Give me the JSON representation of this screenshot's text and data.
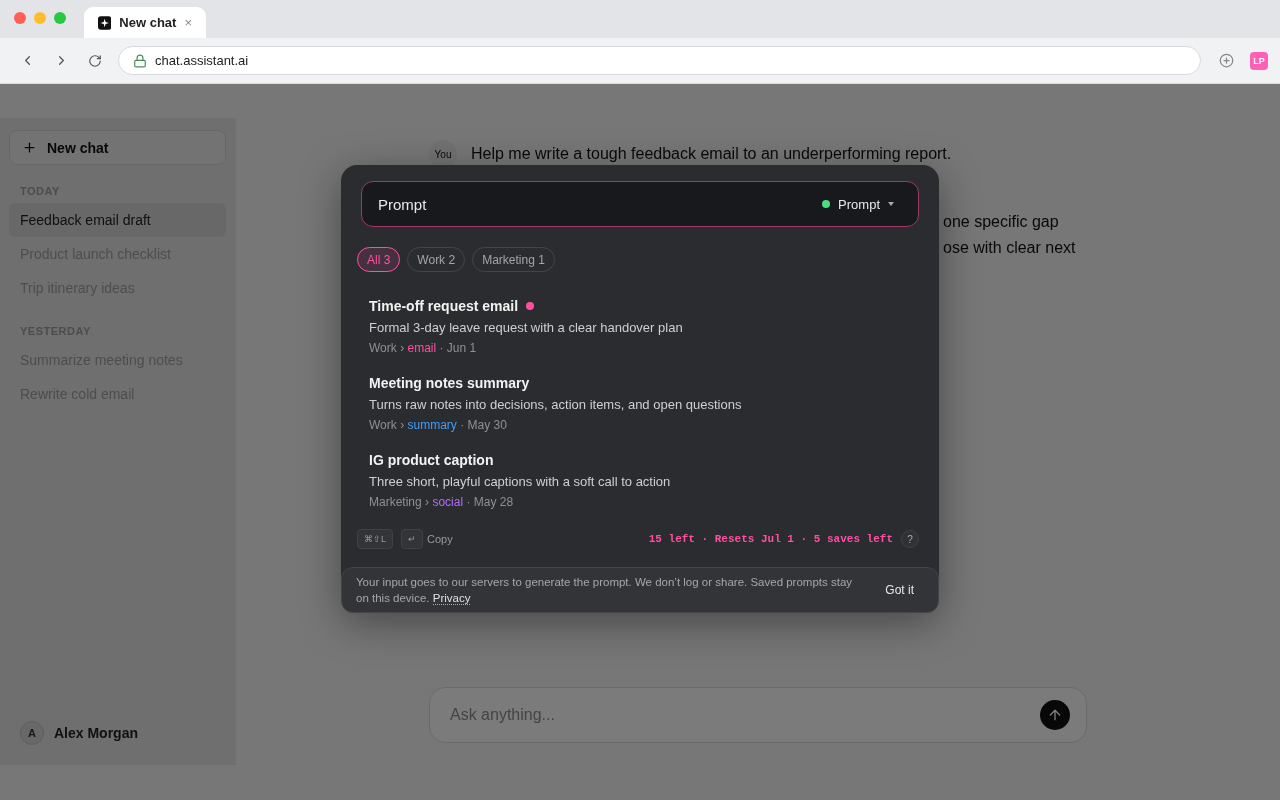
{
  "browser": {
    "tab": {
      "title": "New chat",
      "close": "×",
      "selected": true
    },
    "url": "chat.assistant.ai",
    "extension": "LP"
  },
  "sidebar": {
    "new_chat": "New chat",
    "sections": [
      {
        "heading": "TODAY",
        "items": [
          {
            "label": "Feedback email draft",
            "selected": true
          },
          {
            "label": "Product launch checklist",
            "selected": false
          },
          {
            "label": "Trip itinerary ideas",
            "selected": false
          }
        ]
      },
      {
        "heading": "YESTERDAY",
        "items": [
          {
            "label": "Summarize meeting notes",
            "selected": false
          },
          {
            "label": "Rewrite cold email",
            "selected": false
          }
        ]
      }
    ],
    "user": {
      "initial": "A",
      "name": "Alex Morgan"
    }
  },
  "chat": {
    "messages": [
      {
        "kind": "user",
        "avatar": "You",
        "text": "Help me write a tough feedback email to an underperforming report."
      },
      {
        "kind": "assistant",
        "lines": [
          "one specific gap",
          "ose with clear next"
        ]
      }
    ],
    "composer": {
      "placeholder": "Ask anything..."
    }
  },
  "popup": {
    "input": {
      "value": "Prompt"
    },
    "mode": {
      "label": "Prompt",
      "color": "#4ade80"
    },
    "filters": [
      {
        "label": "All 3",
        "selected": true
      },
      {
        "label": "Work 2",
        "selected": false
      },
      {
        "label": "Marketing 1",
        "selected": false
      }
    ],
    "separators": {
      "path": "›",
      "date": "·"
    },
    "prompts": [
      {
        "title": "Time-off request email",
        "unread": true,
        "description": "Formal 3-day leave request with a clear handover plan",
        "category": "Work",
        "tag": "email",
        "color": "#ff4fa3",
        "date": "Jun 1"
      },
      {
        "title": "Meeting notes summary",
        "unread": false,
        "description": "Turns raw notes into decisions, action items, and open questions",
        "category": "Work",
        "tag": "summary",
        "color": "#3b9eff",
        "date": "May 30"
      },
      {
        "title": "IG product caption",
        "unread": false,
        "description": "Three short, playful captions with a soft call to action",
        "category": "Marketing",
        "tag": "social",
        "color": "#b36bff",
        "date": "May 28"
      }
    ],
    "footer": {
      "shortcut": "⌘⇧L",
      "copy_key": "↵",
      "copy_label": "Copy",
      "quota": "15 left · Resets Jul 1 · 5 saves left",
      "help": "?"
    },
    "notice": {
      "text": "Your input goes to our servers to generate the prompt. We don’t log or share. Saved prompts stay on this device.",
      "link": "Privacy",
      "button": "Got it"
    }
  }
}
